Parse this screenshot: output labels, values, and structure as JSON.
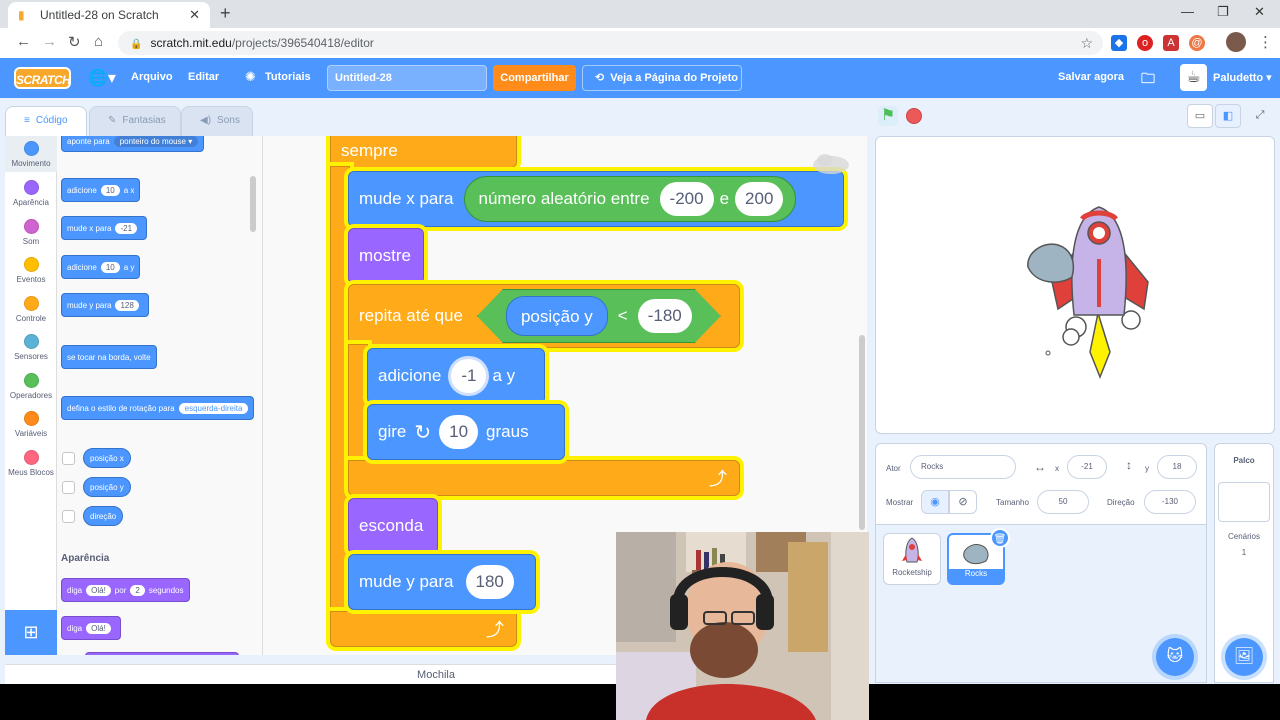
{
  "browser": {
    "tab_title": "Untitled-28 on Scratch",
    "url_domain": "scratch.mit.edu",
    "url_path": "/projects/396540418/editor"
  },
  "menu": {
    "logo": "SCRATCH",
    "file": "Arquivo",
    "edit": "Editar",
    "tutorials": "Tutoriais",
    "project_title": "Untitled-28",
    "share": "Compartilhar",
    "see_project": "Veja a Página do Projeto",
    "save_now": "Salvar agora",
    "username": "Paludetto"
  },
  "editor_tabs": [
    "Código",
    "Fantasias",
    "Sons"
  ],
  "categories": [
    {
      "label": "Movimento",
      "color": "#4c97ff"
    },
    {
      "label": "Aparência",
      "color": "#9966ff"
    },
    {
      "label": "Som",
      "color": "#cf63cf"
    },
    {
      "label": "Eventos",
      "color": "#ffbf00"
    },
    {
      "label": "Controle",
      "color": "#ffab19"
    },
    {
      "label": "Sensores",
      "color": "#5cb1d6"
    },
    {
      "label": "Operadores",
      "color": "#59c059"
    },
    {
      "label": "Variáveis",
      "color": "#ff8c1a"
    },
    {
      "label": "Meus Blocos",
      "color": "#ff6680"
    }
  ],
  "palette": {
    "point_towards": "aponte para",
    "point_towards_value": "ponteiro do mouse",
    "change_x_a": "adicione",
    "change_x_val": "10",
    "change_x_b": "a x",
    "set_x_a": "mude x para",
    "set_x_val": "-21",
    "change_y_a": "adicione",
    "change_y_val": "10",
    "change_y_b": "a y",
    "set_y_a": "mude y para",
    "set_y_val": "128",
    "bounce": "se tocar na borda, volte",
    "rotation_style": "defina o estilo de rotação para",
    "rotation_style_value": "esquerda-direita",
    "rep_x": "posição x",
    "rep_y": "posição y",
    "rep_dir": "direção",
    "looks_heading": "Aparência",
    "say_for_a": "diga",
    "say_for_val": "Olá!",
    "say_for_b": "por",
    "say_for_secs": "2",
    "say_for_c": "segundos",
    "say_a": "diga",
    "say_val": "Olá!"
  },
  "script": {
    "forever": "sempre",
    "set_x": "mude x para",
    "random": "número aleatório entre",
    "random_from": "-200",
    "random_and": "e",
    "random_to": "200",
    "show": "mostre",
    "repeat_until": "repita até que",
    "pos_y": "posição y",
    "lt": "<",
    "lt_val": "-180",
    "change_y": "adicione",
    "change_y_val": "-1",
    "change_y_b": "a y",
    "turn": "gire",
    "turn_val": "10",
    "turn_b": "graus",
    "hide": "esconda",
    "set_y": "mude y para",
    "set_y_val": "180"
  },
  "backpack": "Mochila",
  "sprite_info": {
    "sprite_label": "Ator",
    "sprite_name": "Rocks",
    "x_label": "x",
    "x_val": "-21",
    "y_label": "y",
    "y_val": "18",
    "show_label": "Mostrar",
    "size_label": "Tamanho",
    "size_val": "50",
    "dir_label": "Direção",
    "dir_val": "-130"
  },
  "sprites": [
    "Rocketship",
    "Rocks"
  ],
  "stage_panel": {
    "title": "Palco",
    "backdrops_label": "Cenários",
    "backdrops_count": "1"
  }
}
